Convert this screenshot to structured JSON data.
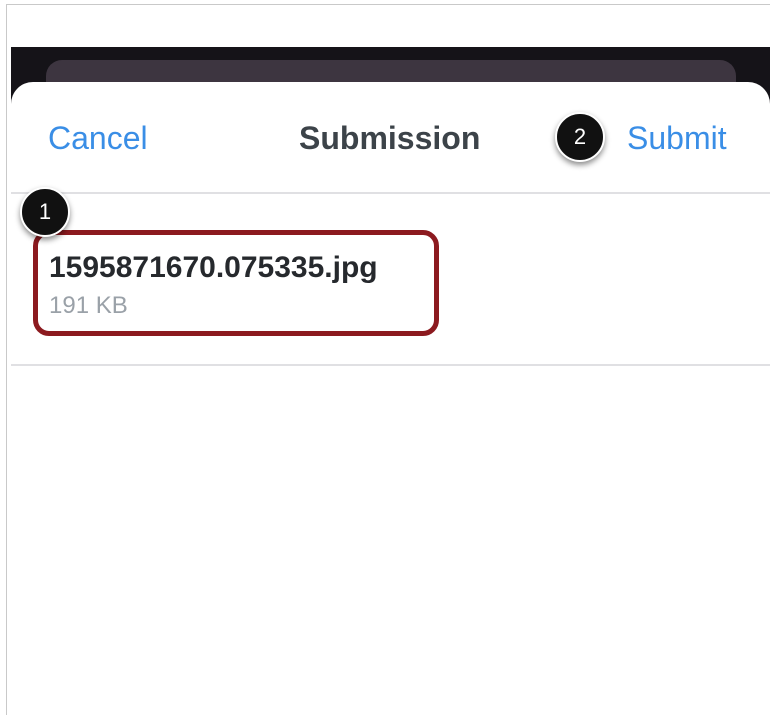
{
  "nav": {
    "cancel_label": "Cancel",
    "title": "Submission",
    "submit_label": "Submit"
  },
  "file": {
    "name": "1595871670.075335.jpg",
    "size": "191 KB"
  },
  "callouts": {
    "one": "1",
    "two": "2"
  },
  "colors": {
    "link": "#3a8ee6",
    "highlight": "#8c1a1f",
    "callout_bg": "#111111"
  }
}
